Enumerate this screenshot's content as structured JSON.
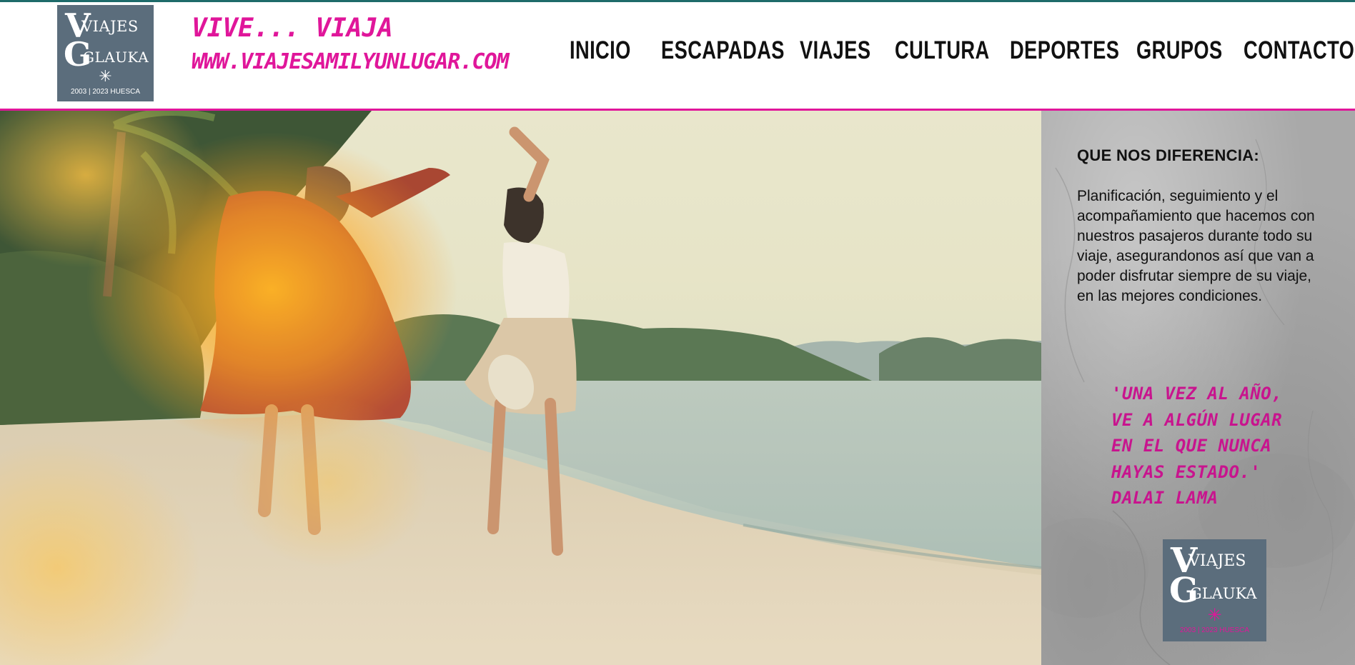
{
  "colors": {
    "accent": "#e0169a",
    "top_line": "#1e6b6a",
    "logo_bg": "#5b6d7c",
    "nav_text": "#111111",
    "quote": "#c8148e"
  },
  "header": {
    "logo": {
      "line1": "VIAJES",
      "line2": "GLAUKA",
      "footer": "2003 | 2023   HUESCA",
      "icon": "compass-star-icon"
    },
    "slogan": {
      "line1": "VIVE... VIAJA",
      "line2": "WWW.VIAJESAMILYUNLUGAR.COM"
    },
    "nav": [
      {
        "label": "INICIO"
      },
      {
        "label": "ESCAPADAS"
      },
      {
        "label": "VIAJES"
      },
      {
        "label": "CULTURA"
      },
      {
        "label": "DEPORTES"
      },
      {
        "label": "GRUPOS"
      },
      {
        "label": "CONTACTO"
      }
    ]
  },
  "hero": {
    "image": "beach-dancing-photo"
  },
  "side": {
    "heading": "QUE NOS DIFERENCIA:",
    "body": "Planificación, seguimiento y el acompañamiento que hacemos con nuestros pasajeros durante todo su viaje, asegurandonos así que van a poder disfrutar siempre de su viaje, en las mejores condiciones.",
    "quote": {
      "lines": [
        "'UNA VEZ AL AÑO,",
        "VE A ALGÚN LUGAR",
        "EN EL QUE NUNCA",
        "HAYAS ESTADO.'",
        "DALAI LAMA"
      ]
    },
    "logo": {
      "line1": "VIAJES",
      "line2": "GLAUKA",
      "footer": "2003 | 2023   HUESCA",
      "icon": "compass-star-icon"
    }
  }
}
